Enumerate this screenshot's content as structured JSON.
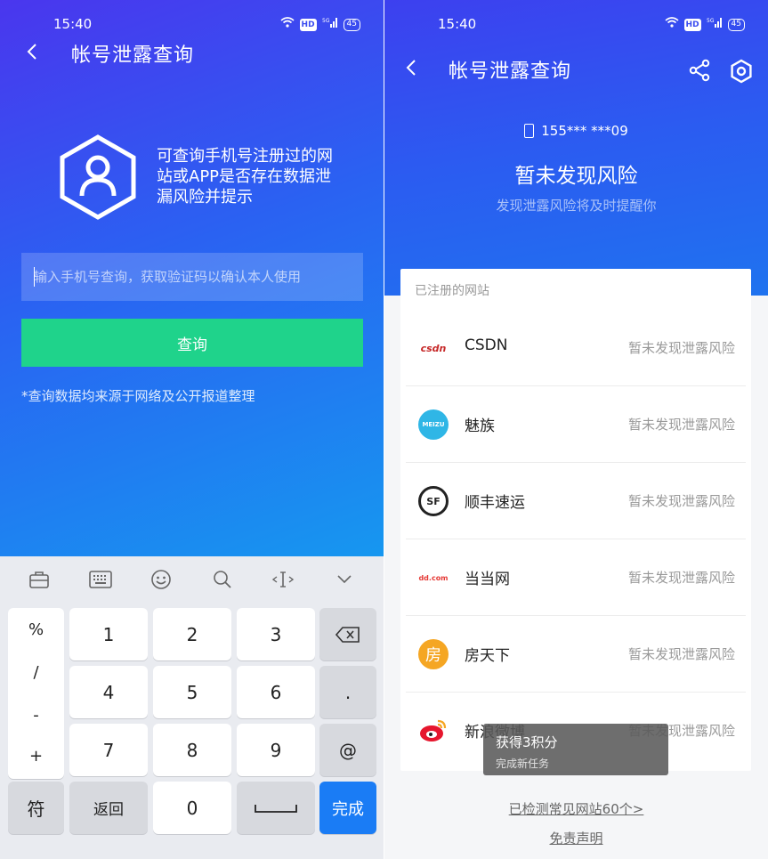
{
  "left": {
    "status": {
      "time": "15:40",
      "battery": "45"
    },
    "title": "帐号泄露查询",
    "description": "可查询手机号注册过的网站或APP是否存在数据泄漏风险并提示",
    "input_placeholder": "输入手机号查询，获取验证码以确认本人使用",
    "query_button": "查询",
    "note": "*查询数据均来源于网络及公开报道整理",
    "keyboard": {
      "symbols": [
        "%",
        "/",
        "-",
        "+"
      ],
      "digits": [
        "1",
        "2",
        "3",
        "4",
        "5",
        "6",
        "7",
        "8",
        "9",
        "0"
      ],
      "dot": ".",
      "at": "@",
      "fu": "符",
      "back": "返回",
      "done": "完成"
    }
  },
  "right": {
    "status": {
      "time": "15:40",
      "battery": "45"
    },
    "title": "帐号泄露查询",
    "phone": "155*** ***09",
    "risk_title": "暂未发现风险",
    "risk_sub": "发现泄露风险将及时提醒你",
    "card_header": "已注册的网站",
    "sites": [
      {
        "name": "CSDN",
        "status": "暂未发现泄露风险",
        "logo": "csdn",
        "color": "#c62828"
      },
      {
        "name": "魅族",
        "status": "暂未发现泄露风险",
        "logo": "MEIZU",
        "color": "#2fb6e6"
      },
      {
        "name": "顺丰速运",
        "status": "暂未发现泄露风险",
        "logo": "SF",
        "color": "#222222"
      },
      {
        "name": "当当网",
        "status": "暂未发现泄露风险",
        "logo": "dd.com",
        "color": "#e53935"
      },
      {
        "name": "房天下",
        "status": "暂未发现泄露风险",
        "logo": "房",
        "color": "#f5a623"
      },
      {
        "name": "新浪微博",
        "status": "暂未发现泄露风险",
        "logo": "weibo",
        "color": "#e6162d"
      }
    ],
    "toast": {
      "title": "获得3积分",
      "sub": "完成新任务"
    },
    "footer_link": "已检测常见网站60个>",
    "disclaimer": "免责声明"
  }
}
